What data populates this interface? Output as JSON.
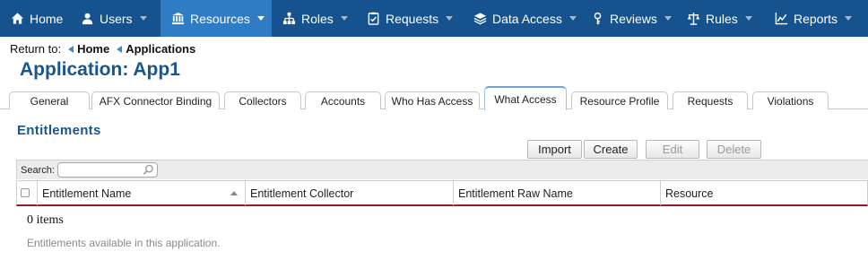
{
  "nav": {
    "items": [
      {
        "label": "Home",
        "icon": "home-icon"
      },
      {
        "label": "Users",
        "icon": "users-icon"
      },
      {
        "label": "Resources",
        "icon": "resources-icon"
      },
      {
        "label": "Roles",
        "icon": "roles-icon"
      },
      {
        "label": "Requests",
        "icon": "requests-icon"
      },
      {
        "label": "Data Access",
        "icon": "data-access-icon"
      },
      {
        "label": "Reviews",
        "icon": "reviews-icon"
      },
      {
        "label": "Rules",
        "icon": "rules-icon"
      },
      {
        "label": "Reports",
        "icon": "reports-icon"
      }
    ],
    "active": "Resources",
    "colors": {
      "bar": "#16538e",
      "active": "#2f7bc4"
    }
  },
  "breadcrumb": {
    "prefix": "Return to:",
    "items": [
      "Home",
      "Applications"
    ]
  },
  "page": {
    "title": "Application: App1",
    "section_title": "Entitlements"
  },
  "tabs": {
    "items": [
      "General",
      "AFX Connector Binding",
      "Collectors",
      "Accounts",
      "Who Has Access",
      "What Access",
      "Resource Profile",
      "Requests",
      "Violations"
    ],
    "active": "What Access"
  },
  "toolbar": {
    "import_label": "Import",
    "create_label": "Create",
    "edit_label": "Edit",
    "delete_label": "Delete"
  },
  "search": {
    "label": "Search:",
    "value": "",
    "icon": "search-icon"
  },
  "grid": {
    "columns": [
      "Entitlement Name",
      "Entitlement Collector",
      "Entitlement Raw Name",
      "Resource"
    ],
    "sorted_column": "Entitlement Name",
    "items_count": "0 items",
    "footer": "Entitlements available in this application."
  }
}
